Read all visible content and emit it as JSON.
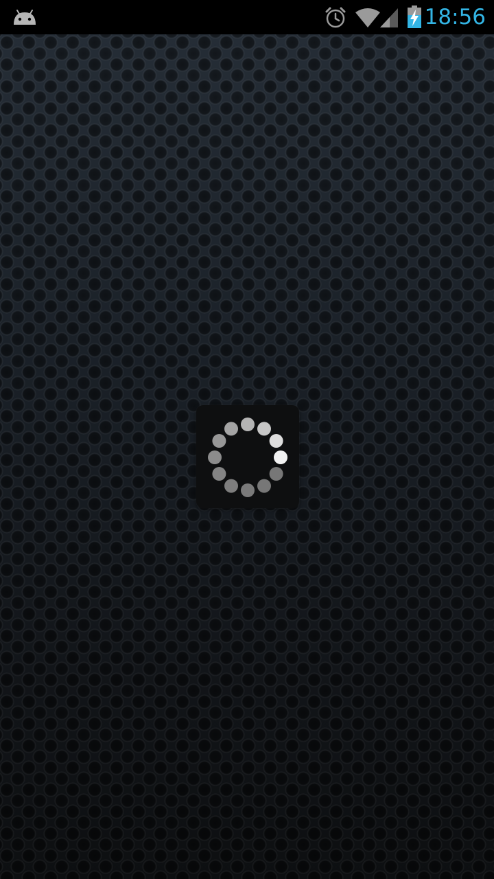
{
  "status_bar": {
    "time": "18:56",
    "notification_icon": "android-icon",
    "icons": [
      "alarm-icon",
      "wifi-icon",
      "signal-icon",
      "battery-charging-icon"
    ],
    "clock_color": "#33b5e5"
  },
  "loading": {
    "indicator": "spinner-icon",
    "dot_count": 12,
    "brightest_dot_index": 3
  }
}
